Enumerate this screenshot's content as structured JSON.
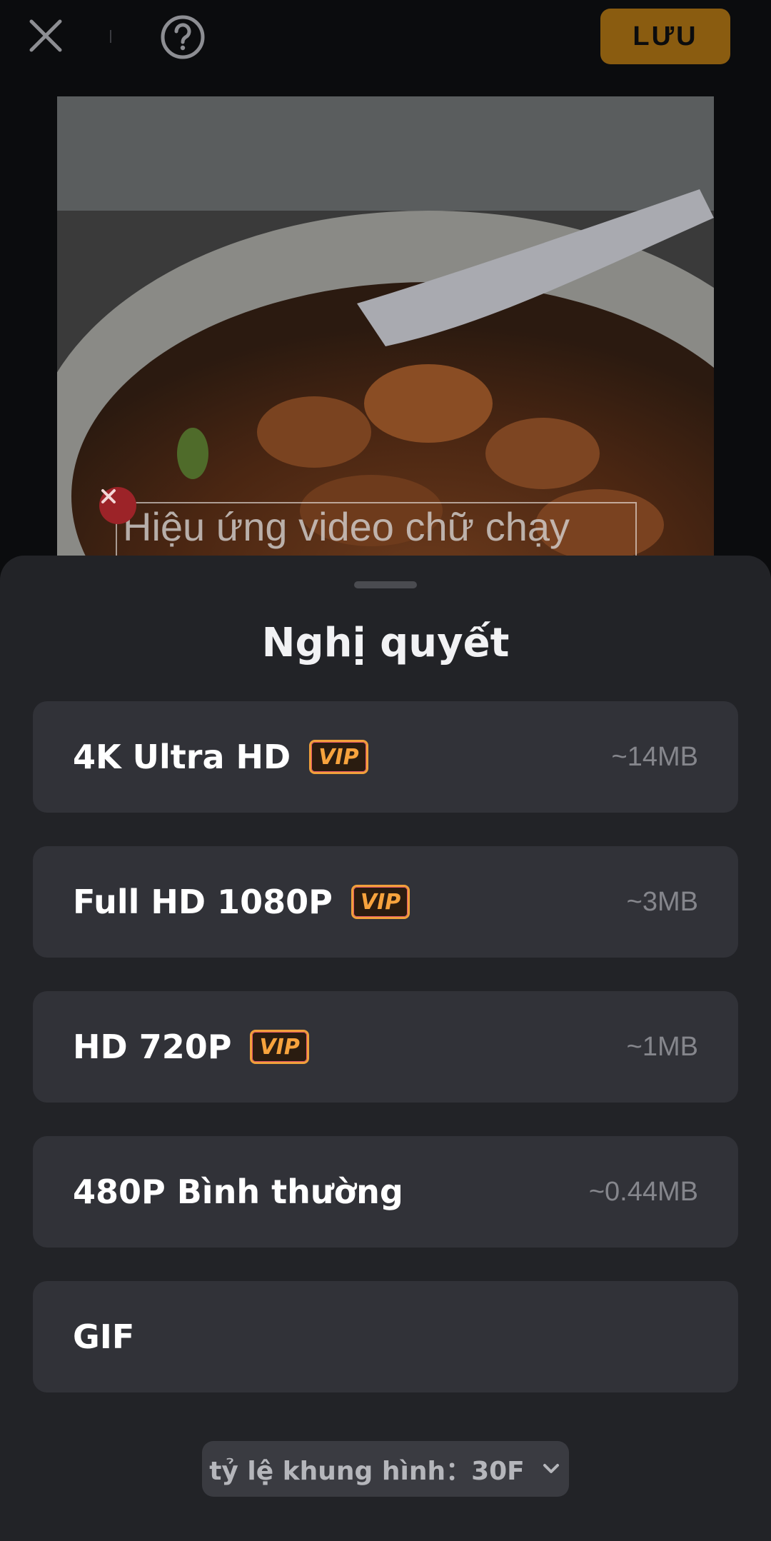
{
  "toolbar": {
    "save_label": "LƯU"
  },
  "preview": {
    "caption": "Hiệu ứng video chữ chạy"
  },
  "sheet": {
    "title": "Nghị quyết",
    "options": [
      {
        "label": "4K Ultra HD",
        "badge": "VIP",
        "size": "~14MB"
      },
      {
        "label": "Full HD 1080P",
        "badge": "VIP",
        "size": "~3MB"
      },
      {
        "label": "HD 720P",
        "badge": "VIP",
        "size": "~1MB"
      },
      {
        "label": "480P Bình thường",
        "size": "~0.44MB"
      },
      {
        "label": "GIF"
      }
    ],
    "framerate_label": "tỷ lệ khung hình：30F"
  },
  "icons": [
    "close-icon",
    "help-icon",
    "delete-caption-icon",
    "chevron-down-icon"
  ],
  "colors": {
    "accent": "#8a5c10",
    "vip": "#f7a33d",
    "sheet_bg": "#222327",
    "option_bg": "#313238"
  }
}
